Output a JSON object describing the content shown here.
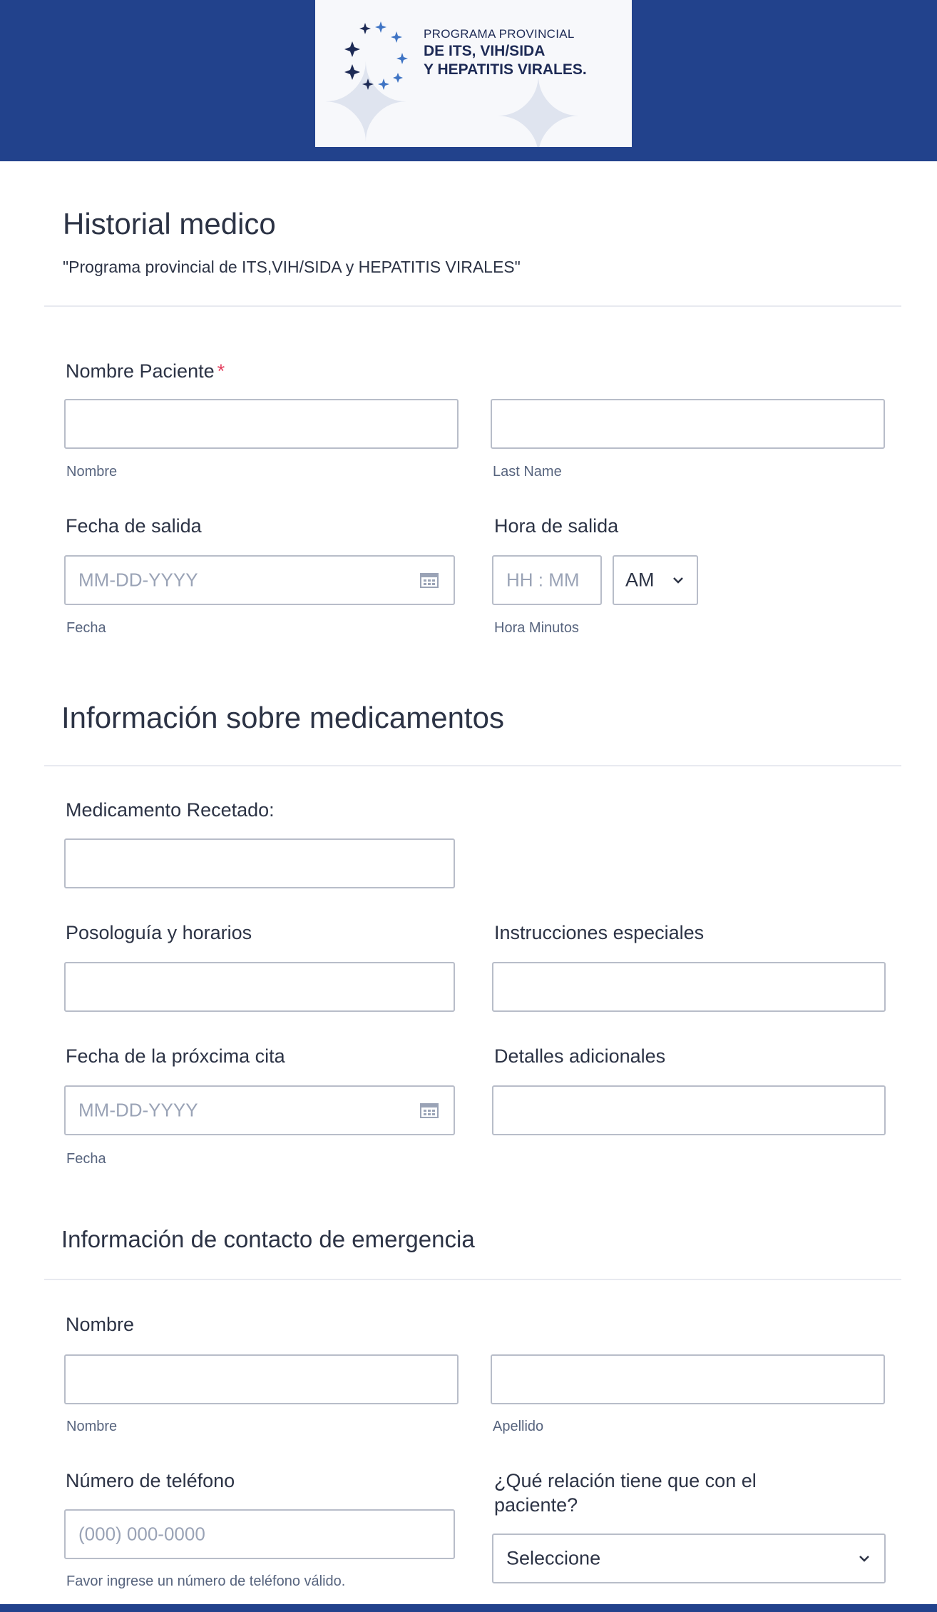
{
  "header": {
    "logo": {
      "line1": "PROGRAMA PROVINCIAL",
      "line2": "DE ITS, VIH/SIDA",
      "line3": "Y HEPATITIS VIRALES."
    }
  },
  "form": {
    "title": "Historial medico",
    "subtitle": "\"Programa provincial de ITS,VIH/SIDA y HEPATITIS VIRALES\""
  },
  "patient": {
    "name_label": "Nombre Paciente",
    "required_mark": "*",
    "first_sublabel": "Nombre",
    "last_sublabel": "Last Name",
    "discharge_date_label": "Fecha de salida",
    "discharge_date_placeholder": "MM-DD-YYYY",
    "discharge_date_sublabel": "Fecha",
    "discharge_time_label": "Hora de salida",
    "discharge_time_placeholder": "HH : MM",
    "ampm_value": "AM",
    "discharge_time_sublabel": "Hora Minutos"
  },
  "medication": {
    "section_title": "Información sobre medicamentos",
    "prescribed_label": "Medicamento Recetado:",
    "dosage_label": "Posologuía y horarios",
    "special_label": "Instrucciones especiales",
    "next_date_label": "Fecha de la próxcima cita",
    "next_date_placeholder": "MM-DD-YYYY",
    "next_date_sublabel": "Fecha",
    "extra_label": "Detalles adicionales"
  },
  "emergency": {
    "section_title": "Información de contacto de emergencia",
    "name_label": "Nombre",
    "first_sublabel": "Nombre",
    "last_sublabel": "Apellido",
    "phone_label": "Número de teléfono",
    "phone_placeholder": "(000) 000-0000",
    "phone_hint": "Favor ingrese un número de teléfono válido.",
    "relation_label_line1": "¿Qué relación tiene que con el",
    "relation_label_line2": "paciente?",
    "relation_value": "Seleccione"
  },
  "colors": {
    "brand": "#22428c",
    "required": "#e4405f"
  }
}
